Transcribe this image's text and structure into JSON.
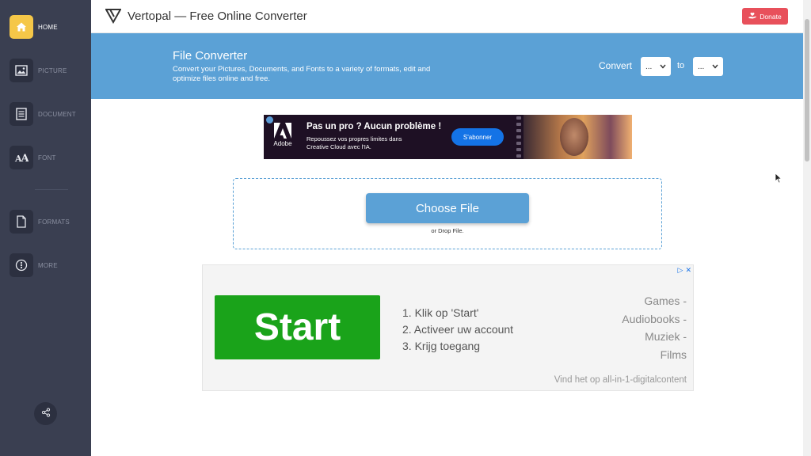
{
  "app": {
    "title": "Vertopal — Free Online Converter"
  },
  "sidebar": {
    "items": [
      {
        "label": "HOME",
        "icon": "home-icon",
        "active": true
      },
      {
        "label": "PICTURE",
        "icon": "picture-icon"
      },
      {
        "label": "DOCUMENT",
        "icon": "document-icon"
      },
      {
        "label": "FONT",
        "icon": "font-icon"
      },
      {
        "label": "FORMATS",
        "icon": "formats-icon"
      },
      {
        "label": "MORE",
        "icon": "more-icon"
      }
    ],
    "share_icon": "share-icon"
  },
  "header": {
    "donate_label": "Donate"
  },
  "banner": {
    "title": "File Converter",
    "subtitle": "Convert your Pictures, Documents, and Fonts to a variety of formats, edit and optimize files online and free.",
    "convert_label": "Convert",
    "from_value": "...",
    "to_label": "to",
    "to_value": "..."
  },
  "ad1": {
    "brand": "Adobe",
    "headline": "Pas un pro ? Aucun problème !",
    "subtext": "Repoussez vos propres limites dans Creative Cloud avec l'IA.",
    "button_label": "S'abonner"
  },
  "upload": {
    "button_label": "Choose File",
    "drop_text": "or Drop File."
  },
  "ad2": {
    "start_label": "Start",
    "steps": [
      "1. Klik op 'Start'",
      "2. Activeer uw account",
      "3. Krijg toegang"
    ],
    "categories": [
      "Games -",
      "Audiobooks -",
      "Muziek -",
      "Films"
    ],
    "footer": "Vind het op all-in-1-digitalcontent"
  },
  "colors": {
    "sidebar_bg": "#3a3f51",
    "accent_blue": "#5ba1d6",
    "home_active": "#f5c748",
    "donate_red": "#e8505b",
    "start_green": "#1aa31a"
  }
}
